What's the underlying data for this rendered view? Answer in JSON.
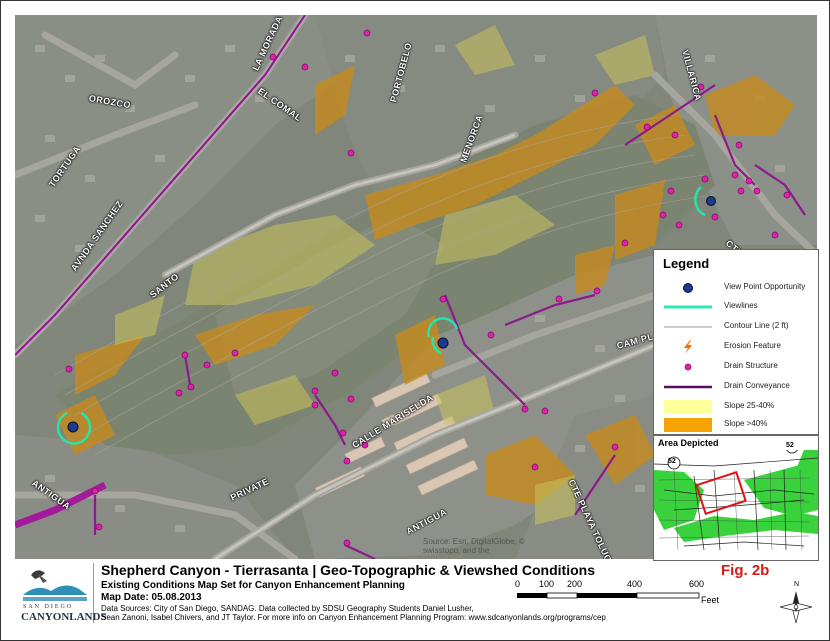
{
  "map": {
    "street_labels": {
      "la_morada": "LA MORADA",
      "el_comal": "EL COMAL",
      "portobelo": "PORTOBELO",
      "menorca": "MENORCA",
      "villarica": "VILLARICA",
      "orozco": "OROZCO",
      "tortuga": "TORTUGA",
      "avnda_sanchez": "AVNDA SANCHEZ",
      "santo": "SANTO",
      "cte_pl": "CTE PL",
      "cam_pl": "CAM PL",
      "calle_mariselda": "CALLE MARISELDA",
      "private": "PRIVATE",
      "antigua_1": "ANTIGUA",
      "antigua_2": "ANTIGUA",
      "cte_playa_toluca": "CTE PLAYA TOLUCA"
    },
    "source_credit_line1": "Source: Esri, DigitalGlobe, ©",
    "source_credit_line2": "swisstopo, and the"
  },
  "legend": {
    "title": "Legend",
    "items": [
      {
        "label": "View Point Opportunity",
        "symbol": "blue-dot-icon",
        "color": "#1d3b8c"
      },
      {
        "label": "Viewlines",
        "symbol": "teal-line",
        "color": "#2ee6b0"
      },
      {
        "label": "Contour Line (2 ft)",
        "symbol": "gray-line",
        "color": "#9a9a9a"
      },
      {
        "label": "Erosion Feature",
        "symbol": "lightning-icon",
        "color": "#ff6a00"
      },
      {
        "label": "Drain Structure",
        "symbol": "magenta-dot-icon",
        "color": "#e020b0"
      },
      {
        "label": "Drain Conveyance",
        "symbol": "purple-line",
        "color": "#5a0a5a"
      },
      {
        "label": "Slope 25-40%",
        "symbol": "yellow-fill",
        "color": "#ffff99"
      },
      {
        "label": "Slope >40%",
        "symbol": "orange-fill",
        "color": "#f5a300"
      }
    ]
  },
  "inset": {
    "title": "Area Depicted",
    "route_labels": [
      "52",
      "52"
    ]
  },
  "footer": {
    "title": "Shepherd Canyon - Tierrasanta | Geo-Topographic & Viewshed Conditions",
    "subtitle": "Existing Conditions Map Set for Canyon Enhancement Planning",
    "map_date": "Map Date: 05.08.2013",
    "sources_line1": "Data Sources: City of San Diego, SANDAG.  Data collected by SDSU Geography Students Daniel Lusher,",
    "sources_line2": "Sean Zanoni, Isabel Chivers, and JT Taylor. For more info on Canyon Enhancement Planning Program: www.sdcanyonlands.org/programs/cep",
    "figure_label": "Fig. 2b",
    "logo_line1": "SAN DIEGO",
    "logo_line2": "CANYONLANDS",
    "scale_ticks": [
      "0",
      "100",
      "200",
      "400",
      "600"
    ],
    "scale_unit": "Feet",
    "north_label": "N"
  }
}
